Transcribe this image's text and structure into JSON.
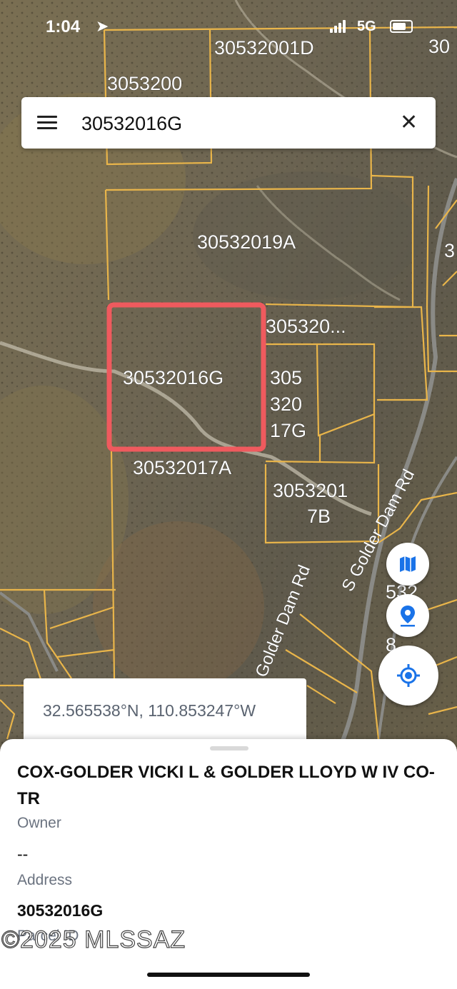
{
  "status_bar": {
    "time": "1:04",
    "network": "5G"
  },
  "search": {
    "query": "30532016G",
    "close_label": "✕"
  },
  "map": {
    "selected_parcel": "30532016G",
    "parcel_labels": {
      "p_001d": "30532001D",
      "p_200": "3053200",
      "p_30": "30",
      "p_019a": "30532019A",
      "p_3": "3",
      "p_320": "305320...",
      "p_017g_1": "305",
      "p_017g_2": "320",
      "p_017g_3": "17G",
      "p_017a": "30532017A",
      "p_017b_1": "3053201",
      "p_017b_2": "7B",
      "p_532": "532",
      "p_8": "8"
    },
    "roads": {
      "road1": "S Golder Dam Rd",
      "road2": "Golder Dam Rd"
    }
  },
  "coordinates": "32.565538°N, 110.853247°W",
  "sheet": {
    "owner_name": "COX-GOLDER VICKI L & GOLDER LLOYD W IV CO-TR",
    "owner_label": "Owner",
    "address_value": "--",
    "address_label": "Address",
    "parcel_id": "30532016G",
    "parcel_label": "Parcel ID",
    "watermark": "©2025 MLSSAZ"
  },
  "colors": {
    "parcel_line": "#e9b54a",
    "selection": "#ef5a5e",
    "accent": "#1a73e8"
  }
}
